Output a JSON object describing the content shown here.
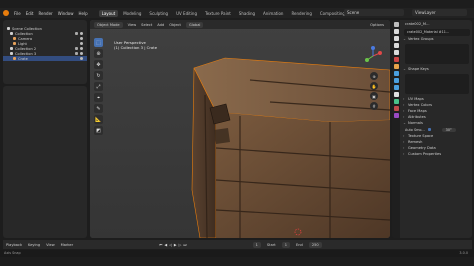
{
  "topbar": {
    "menus": [
      "File",
      "Edit",
      "Render",
      "Window",
      "Help"
    ],
    "workspaces": [
      "Layout",
      "Modeling",
      "Sculpting",
      "UV Editing",
      "Texture Paint",
      "Shading",
      "Animation",
      "Rendering",
      "Compositing",
      "Geometry Nod"
    ],
    "active_workspace": "Layout",
    "scene": "Scene",
    "view_layer": "ViewLayer"
  },
  "outliner": {
    "rows": [
      {
        "label": "Scene Collection",
        "color": "#cfcfcf",
        "selected": false
      },
      {
        "label": "Collection",
        "color": "#cfcfcf",
        "selected": false
      },
      {
        "label": "Camera",
        "color": "#e6a15a",
        "selected": false
      },
      {
        "label": "Light",
        "color": "#e6a15a",
        "selected": false
      },
      {
        "label": "Collection 2",
        "color": "#cfcfcf",
        "selected": false
      },
      {
        "label": "Collection 3",
        "color": "#cfcfcf",
        "selected": false
      },
      {
        "label": "Crate",
        "color": "#e6a15a",
        "selected": true
      }
    ]
  },
  "viewport": {
    "mode": "Object Mode",
    "menus": [
      "View",
      "Select",
      "Add",
      "Object"
    ],
    "orientation": "Global",
    "options_label": "Options",
    "info_line1": "User Perspective",
    "info_line2": "(1) Collection 3 | Crate",
    "tools": [
      "cursor",
      "move",
      "rotate",
      "scale",
      "transform",
      "annotate",
      "measure",
      "add-cube"
    ]
  },
  "properties": {
    "object_name": "crate002_M...",
    "material_name": "crate002_Material #11...",
    "sections": [
      {
        "label": "Vertex Groups",
        "open": true
      },
      {
        "label": "Shape Keys",
        "open": true
      },
      {
        "label": "UV Maps",
        "open": false
      },
      {
        "label": "Vertex Colors",
        "open": false
      },
      {
        "label": "Face Maps",
        "open": false
      },
      {
        "label": "Attributes",
        "open": false
      },
      {
        "label": "Normals",
        "open": false
      },
      {
        "label": "Auto Smo...",
        "open": false
      },
      {
        "label": "Texture Space",
        "open": false
      },
      {
        "label": "Remesh",
        "open": false
      },
      {
        "label": "Geometry Data",
        "open": false
      },
      {
        "label": "Custom Properties",
        "open": false
      }
    ],
    "auto_smooth_value": "30°"
  },
  "timeline": {
    "playback": "Playback",
    "keying": "Keying",
    "view": "View",
    "marker": "Marker",
    "current_frame": "1",
    "start_label": "Start",
    "start": "1",
    "end_label": "End",
    "end": "250"
  },
  "statusbar": {
    "left": "Axis Snap",
    "right": "3.0.0"
  },
  "colors": {
    "accent": "#4772b3",
    "selection_orange": "#e87d0d"
  }
}
